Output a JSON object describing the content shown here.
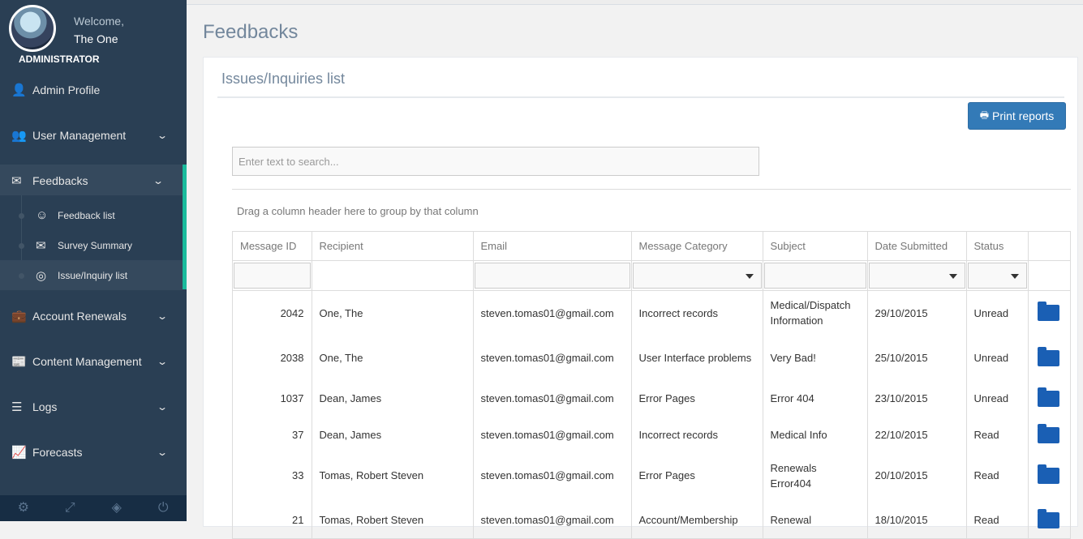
{
  "profile": {
    "welcome": "Welcome,",
    "name": "The One",
    "role": "ADMINISTRATOR"
  },
  "nav": [
    {
      "label": "Admin Profile",
      "icon": "user-icon",
      "glyph": "👤",
      "chevron": false
    },
    {
      "label": "User Management",
      "icon": "users-icon",
      "glyph": "👥",
      "chevron": true
    },
    {
      "label": "Feedbacks",
      "icon": "envelope-icon",
      "glyph": "✉",
      "chevron": true,
      "active": true
    },
    {
      "label": "Account Renewals",
      "icon": "briefcase-icon",
      "glyph": "💼",
      "chevron": true
    },
    {
      "label": "Content Management",
      "icon": "newspaper-icon",
      "glyph": "📰",
      "chevron": true
    },
    {
      "label": "Logs",
      "icon": "list-icon",
      "glyph": "☰",
      "chevron": true
    },
    {
      "label": "Forecasts",
      "icon": "area-chart-icon",
      "glyph": "📈",
      "chevron": true
    }
  ],
  "submenu": [
    {
      "label": "Feedback list",
      "icon": "smile-icon",
      "glyph": "☺"
    },
    {
      "label": "Survey Summary",
      "icon": "envelope-icon",
      "glyph": "✉"
    },
    {
      "label": "Issue/Inquiry list",
      "icon": "life-ring-icon",
      "glyph": "◎",
      "current": true
    }
  ],
  "footer_icons": [
    "gear-icon",
    "fullscreen-icon",
    "eye-slash-icon",
    "power-icon"
  ],
  "page": {
    "title": "Feedbacks"
  },
  "panel": {
    "title": "Issues/Inquiries list",
    "print_label": "Print reports",
    "search_placeholder": "Enter text to search...",
    "group_hint": "Drag a column header here to group by that column"
  },
  "table": {
    "columns": [
      "Message ID",
      "Recipient",
      "Email",
      "Message Category",
      "Subject",
      "Date Submitted",
      "Status",
      ""
    ],
    "rows": [
      {
        "id": "2042",
        "recipient": "One, The",
        "email": "steven.tomas01@gmail.com",
        "category": "Incorrect records",
        "subject": "Medical/Dispatch Information",
        "date": "29/10/2015",
        "status": "Unread"
      },
      {
        "id": "2038",
        "recipient": "One, The",
        "email": "steven.tomas01@gmail.com",
        "category": "User Interface problems",
        "subject": "Very Bad!",
        "date": "25/10/2015",
        "status": "Unread"
      },
      {
        "id": "1037",
        "recipient": "Dean, James",
        "email": "steven.tomas01@gmail.com",
        "category": "Error Pages",
        "subject": "Error 404",
        "date": "23/10/2015",
        "status": "Unread"
      },
      {
        "id": "37",
        "recipient": "Dean, James",
        "email": "steven.tomas01@gmail.com",
        "category": "Incorrect records",
        "subject": "Medical Info",
        "date": "22/10/2015",
        "status": "Read"
      },
      {
        "id": "33",
        "recipient": "Tomas, Robert Steven",
        "email": "steven.tomas01@gmail.com",
        "category": "Error Pages",
        "subject": "Renewals Error404",
        "date": "20/10/2015",
        "status": "Read"
      },
      {
        "id": "21",
        "recipient": "Tomas, Robert Steven",
        "email": "steven.tomas01@gmail.com",
        "category": "Account/Membership",
        "subject": "Renewal",
        "date": "18/10/2015",
        "status": "Read"
      }
    ]
  },
  "colors": {
    "sidebar": "#2a3f54",
    "accent": "#1abb9c",
    "button": "#337ab7",
    "folder": "#1a5fb4"
  }
}
